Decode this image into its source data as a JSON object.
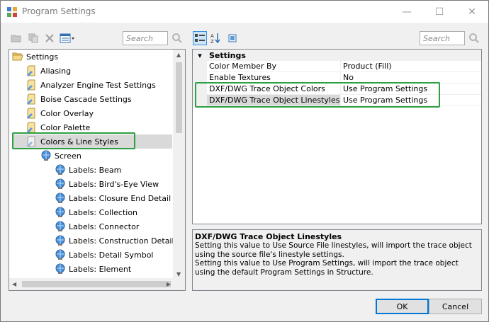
{
  "window": {
    "title": "Program Settings",
    "minimize_icon": "minimize-icon",
    "maximize_icon": "maximize-icon",
    "close_icon": "close-icon",
    "minimize_glyph": "—",
    "maximize_glyph": "☐",
    "close_glyph": "✕"
  },
  "left_toolbar": {
    "search_placeholder": "Search"
  },
  "right_toolbar": {
    "search_placeholder": "Search"
  },
  "tree": {
    "root": "Settings",
    "items": [
      {
        "label": "Aliasing"
      },
      {
        "label": "Analyzer Engine Test Settings"
      },
      {
        "label": "Boise Cascade Settings"
      },
      {
        "label": "Color Overlay"
      },
      {
        "label": "Color Palette"
      },
      {
        "label": "Colors & Line Styles"
      },
      {
        "label": "Screen"
      },
      {
        "label": "Labels: Beam"
      },
      {
        "label": "Labels: Bird's-Eye View"
      },
      {
        "label": "Labels: Closure End Detail Type"
      },
      {
        "label": "Labels: Collection"
      },
      {
        "label": "Labels: Connector"
      },
      {
        "label": "Labels: Construction Details"
      },
      {
        "label": "Labels: Detail Symbol"
      },
      {
        "label": "Labels: Element"
      }
    ]
  },
  "grid": {
    "category": "Settings",
    "collapse_glyph": "▾",
    "rows": [
      {
        "name": "Color Member By",
        "value": "Product (Fill)"
      },
      {
        "name": "Enable Textures",
        "value": "No"
      },
      {
        "name": "DXF/DWG Trace Object Colors",
        "value": "Use Program Settings"
      },
      {
        "name": "DXF/DWG Trace Object Linestyles",
        "value": "Use Program Settings"
      }
    ]
  },
  "description": {
    "title": "DXF/DWG Trace Object Linestyles",
    "line1": "Setting this value to Use Source File linestyles, will import the trace object using the source file's linestyle settings.",
    "line2": "Setting this value to Use Program Settings, will import the trace object using the default Program Settings in Structure."
  },
  "buttons": {
    "ok": "OK",
    "cancel": "Cancel"
  },
  "colors": {
    "highlight": "#2ea043",
    "selection": "#d9d9d9",
    "ok_border": "#0078d7"
  }
}
